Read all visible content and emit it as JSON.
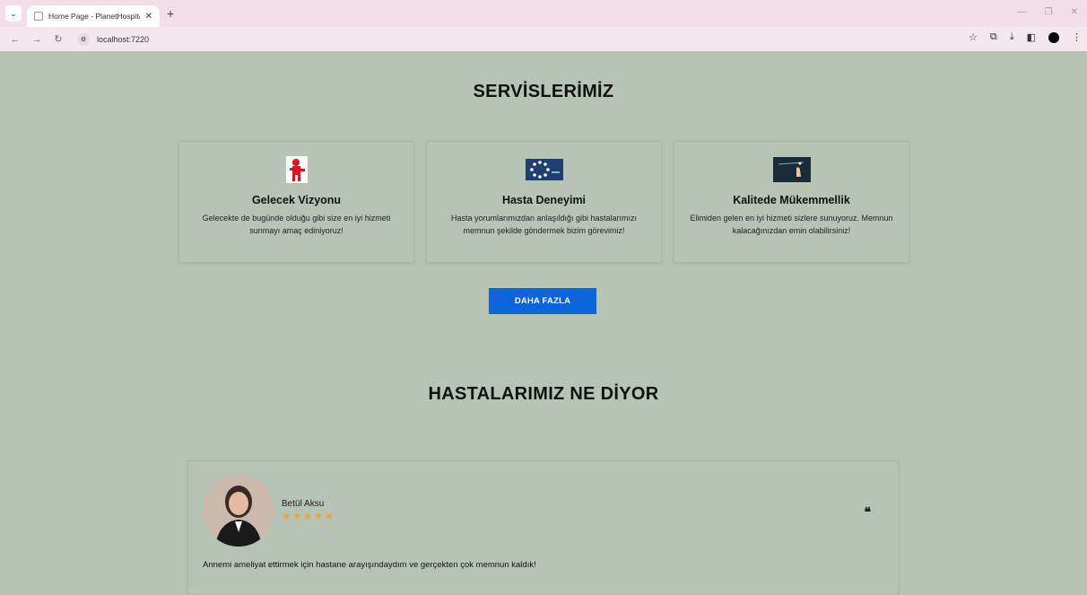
{
  "browser": {
    "tab_title": "Home Page - PlanetHospital",
    "tab_close": "✕",
    "new_tab": "+",
    "url": "localhost:7220"
  },
  "services": {
    "title": "SERVİSLERİMİZ",
    "cards": [
      {
        "title": "Gelecek Vizyonu",
        "description": "Gelecekte de bugünde olduğu gibi size en iyi hizmeti sunmayı amaç ediniyoruz!",
        "icon": "red-figure-icon"
      },
      {
        "title": "Hasta Deneyimi",
        "description": "Hasta yorumlarımızdan anlaşıldığı gibi hastalarımızı memnun şekilde göndermek bizim görevimiz!",
        "icon": "circle-dots-icon"
      },
      {
        "title": "Kalitede Mükemmellik",
        "description": "Elimiden gelen en iyi hizmeti sizlere sunuyoruz. Memnun kalacağınızdan emin olabilirsiniz!",
        "icon": "hand-sparkle-icon"
      }
    ],
    "more_button": "DAHA FAZLA"
  },
  "testimonials": {
    "title": "HASTALARIMIZ NE DİYOR",
    "items": [
      {
        "name": "Betül Aksu",
        "stars": "★★★★★",
        "quote_mark": "❝",
        "text": "Annemi ameliyat ettirmek için hastane arayışındaydım ve gerçekten çok memnun kaldık!"
      }
    ]
  },
  "colors": {
    "page_bg": "#b6c4b6",
    "button_bg": "#0d63d8",
    "star": "#f0a53a"
  }
}
